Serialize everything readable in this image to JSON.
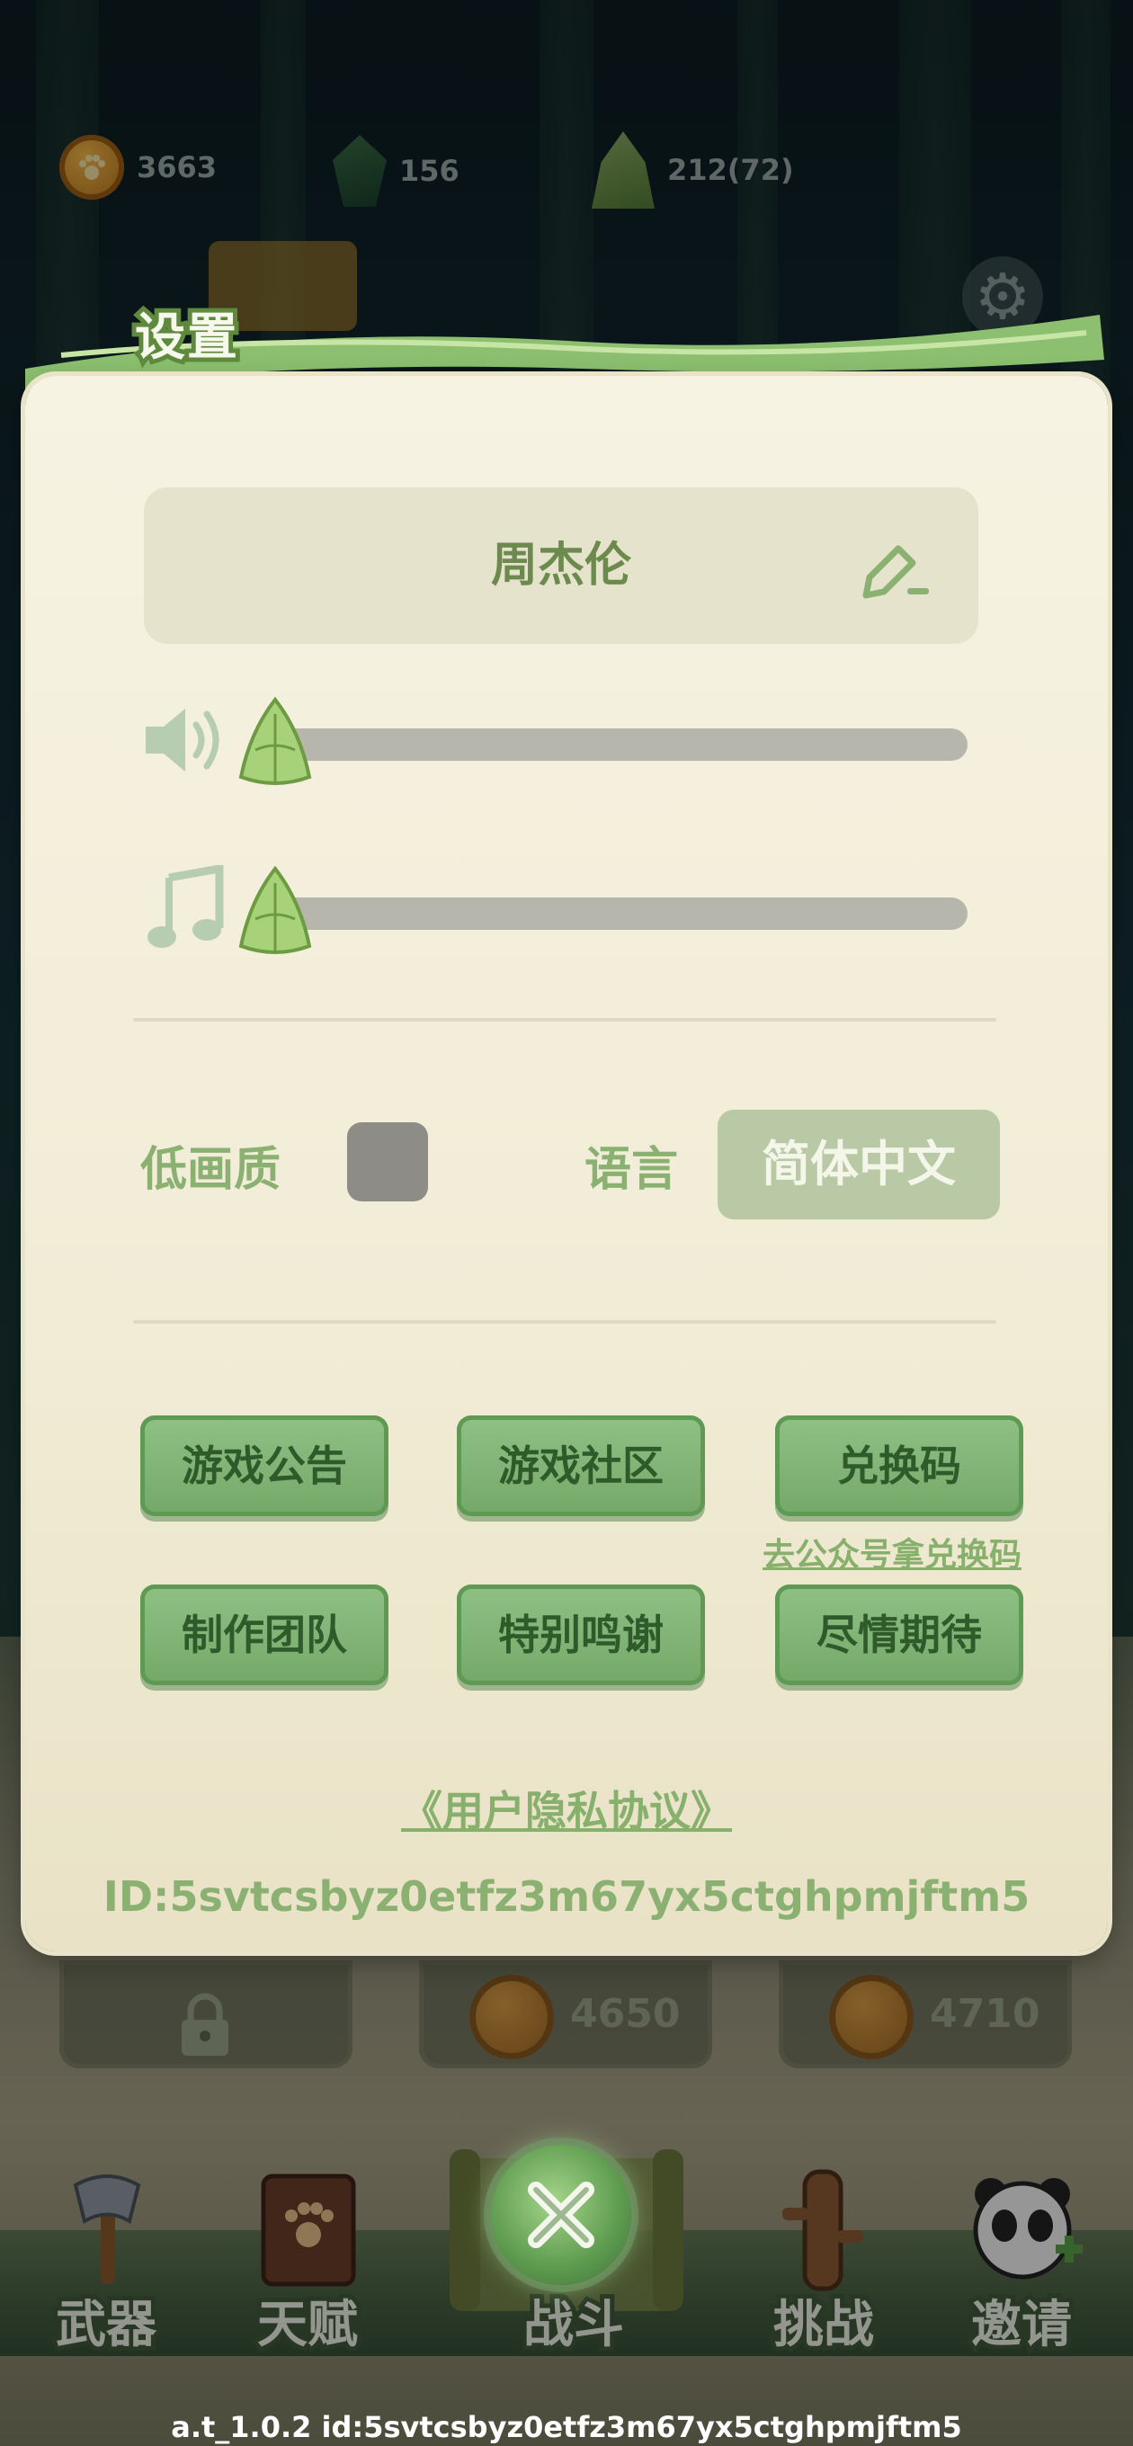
{
  "currencies": [
    {
      "icon": "paw-coin-icon",
      "value": "3663"
    },
    {
      "icon": "jade-leaf-icon",
      "value": "156"
    },
    {
      "icon": "bamboo-shoot-icon",
      "value": "212(72)"
    }
  ],
  "settings": {
    "title": "设置",
    "username": "周杰伦",
    "sound_level": 0,
    "music_level": 0,
    "low_quality_label": "低画质",
    "low_quality_checked": false,
    "language_label": "语言",
    "language_value": "简体中文",
    "buttons": [
      {
        "label": "游戏公告"
      },
      {
        "label": "游戏社区"
      },
      {
        "label": "兑换码"
      },
      {
        "label": "制作团队"
      },
      {
        "label": "特别鸣谢"
      },
      {
        "label": "尽情期待"
      }
    ],
    "redeem_link": "去公众号拿兑换码",
    "privacy_link": "《用户隐私协议》",
    "user_id": "ID:5svtcsbyz0etfz3m67yx5ctghpmjftm5"
  },
  "cards": [
    {
      "locked": true,
      "value": ""
    },
    {
      "locked": false,
      "value": "4650"
    },
    {
      "locked": false,
      "value": "4710"
    }
  ],
  "nav": [
    {
      "label": "武器",
      "icon": "axe-icon"
    },
    {
      "label": "天赋",
      "icon": "paw-book-icon"
    },
    {
      "label": "战斗",
      "icon": "scroll-icon"
    },
    {
      "label": "挑战",
      "icon": "wooden-dummy-icon"
    },
    {
      "label": "邀请",
      "icon": "panda-plus-icon"
    }
  ],
  "footer": "a.t_1.0.2 id:5svtcsbyz0etfz3m67yx5ctghpmjftm5",
  "colors": {
    "accent": "#8bb172",
    "button": "#7fb573",
    "panel": "#f3efdc"
  }
}
